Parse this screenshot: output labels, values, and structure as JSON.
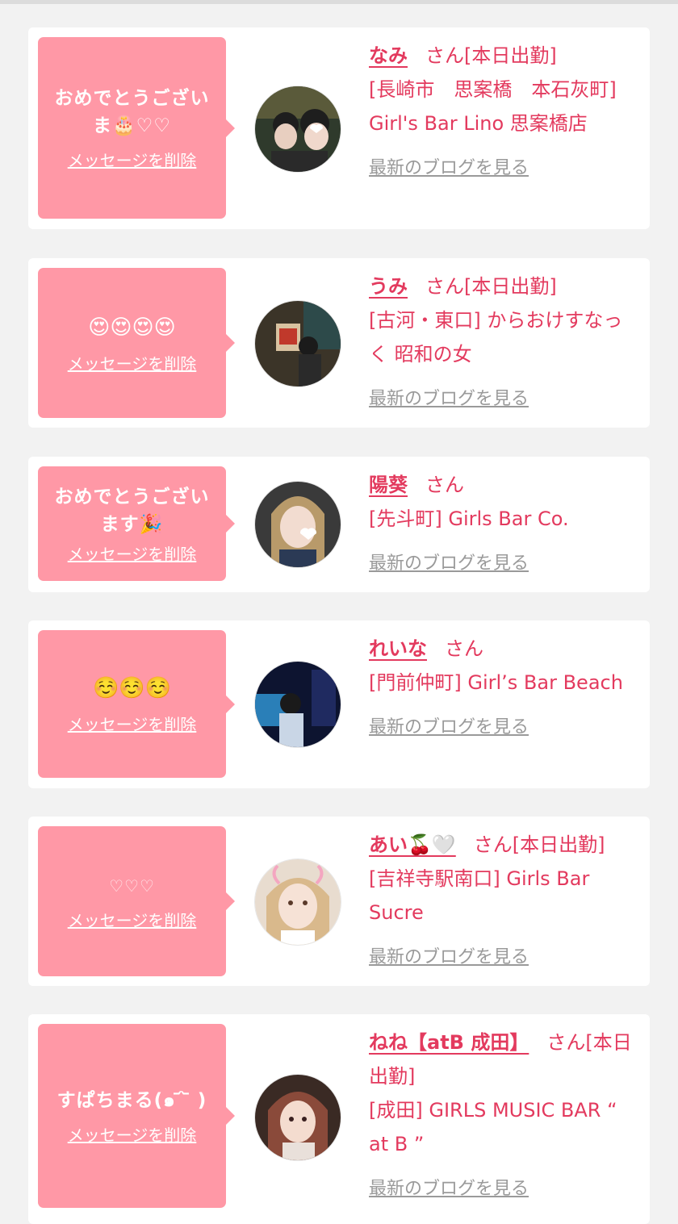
{
  "messages": [
    {
      "text": "おめでとうございま🎂♡♡",
      "delete_label": "メッセージを削除",
      "name": "なみ",
      "san": "さん",
      "status": "[本日出勤]",
      "shop": "[長崎市　思案橋　本石灰町] Girl's Bar Lino 思案橋店",
      "blog_label": "最新のブログを見る"
    },
    {
      "text": "😍😍😍😍",
      "delete_label": "メッセージを削除",
      "name": "うみ",
      "san": "さん",
      "status": "[本日出勤]",
      "shop": "[古河・東口] からおけすなっく 昭和の女",
      "blog_label": "最新のブログを見る"
    },
    {
      "text": "おめでとうございます🎉",
      "delete_label": "メッセージを削除",
      "name": "陽葵",
      "san": "さん",
      "status": "",
      "shop": "[先斗町] Girls Bar Co.",
      "blog_label": "最新のブログを見る"
    },
    {
      "text": "☺️☺️☺️",
      "delete_label": "メッセージを削除",
      "name": "れいな",
      "san": "さん",
      "status": "",
      "shop": "[門前仲町] Girl’s Bar Beach",
      "blog_label": "最新のブログを見る"
    },
    {
      "text": "♡♡♡",
      "delete_label": "メッセージを削除",
      "name": "あい🍒🤍",
      "san": "さん",
      "status": "[本日出勤]",
      "shop": "[吉祥寺駅南口] Girls Bar Sucre",
      "blog_label": "最新のブログを見る"
    },
    {
      "text": "すぱちまる(๑ ᷄ ᷅ )",
      "delete_label": "メッセージを削除",
      "name": "ねね【atB 成田】",
      "san": "さん",
      "status": "[本日出勤]",
      "shop": "[成田] GIRLS MUSIC BAR “ at B ”",
      "blog_label": "最新のブログを見る"
    }
  ],
  "colors": {
    "bubble": "#ff98a6",
    "accent": "#e33a5e",
    "link_gray": "#9a9a9a",
    "page_bg": "#f2f2f2"
  }
}
